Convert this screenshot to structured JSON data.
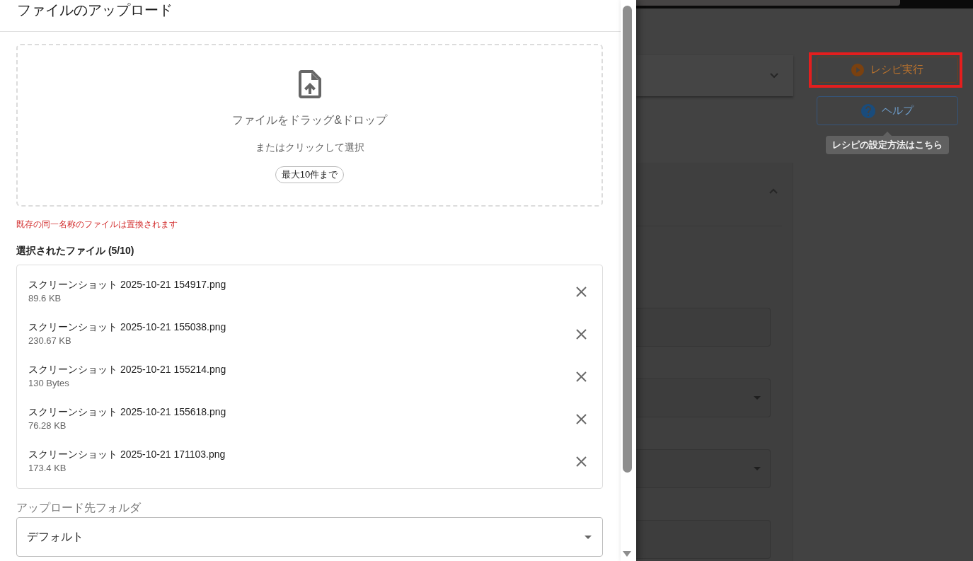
{
  "upload_dialog": {
    "title": "ファイルのアップロード",
    "drop_zone": {
      "instruction": "ファイルをドラッグ&ドロップ",
      "hint": "またはクリックして選択",
      "limit_badge": "最大10件まで"
    },
    "warning": "既存の同一名称のファイルは置換されます",
    "selected_files": {
      "heading": "選択されたファイル (5/10)",
      "files": [
        {
          "name": "スクリーンショット 2025-10-21 154917.png",
          "size": "89.6 KB"
        },
        {
          "name": "スクリーンショット 2025-10-21 155038.png",
          "size": "230.67 KB"
        },
        {
          "name": "スクリーンショット 2025-10-21 155214.png",
          "size": "130 Bytes"
        },
        {
          "name": "スクリーンショット 2025-10-21 155618.png",
          "size": "76.28 KB"
        },
        {
          "name": "スクリーンショット 2025-10-21 171103.png",
          "size": "173.4 KB"
        }
      ]
    },
    "folder": {
      "label": "アップロード先フォルダ",
      "value": "デフォルト"
    }
  },
  "background_page": {
    "cards": [
      {
        "expanded": false
      },
      {
        "expanded": true,
        "fields": [
          {
            "kind": "input"
          },
          {
            "kind": "select"
          },
          {
            "kind": "select"
          },
          {
            "kind": "input"
          }
        ]
      }
    ],
    "run_button": {
      "label": "レシピ実行",
      "highlighted": true
    },
    "help_button": {
      "label": "ヘルプ"
    },
    "tooltip": "レシピの設定方法はこちら"
  }
}
